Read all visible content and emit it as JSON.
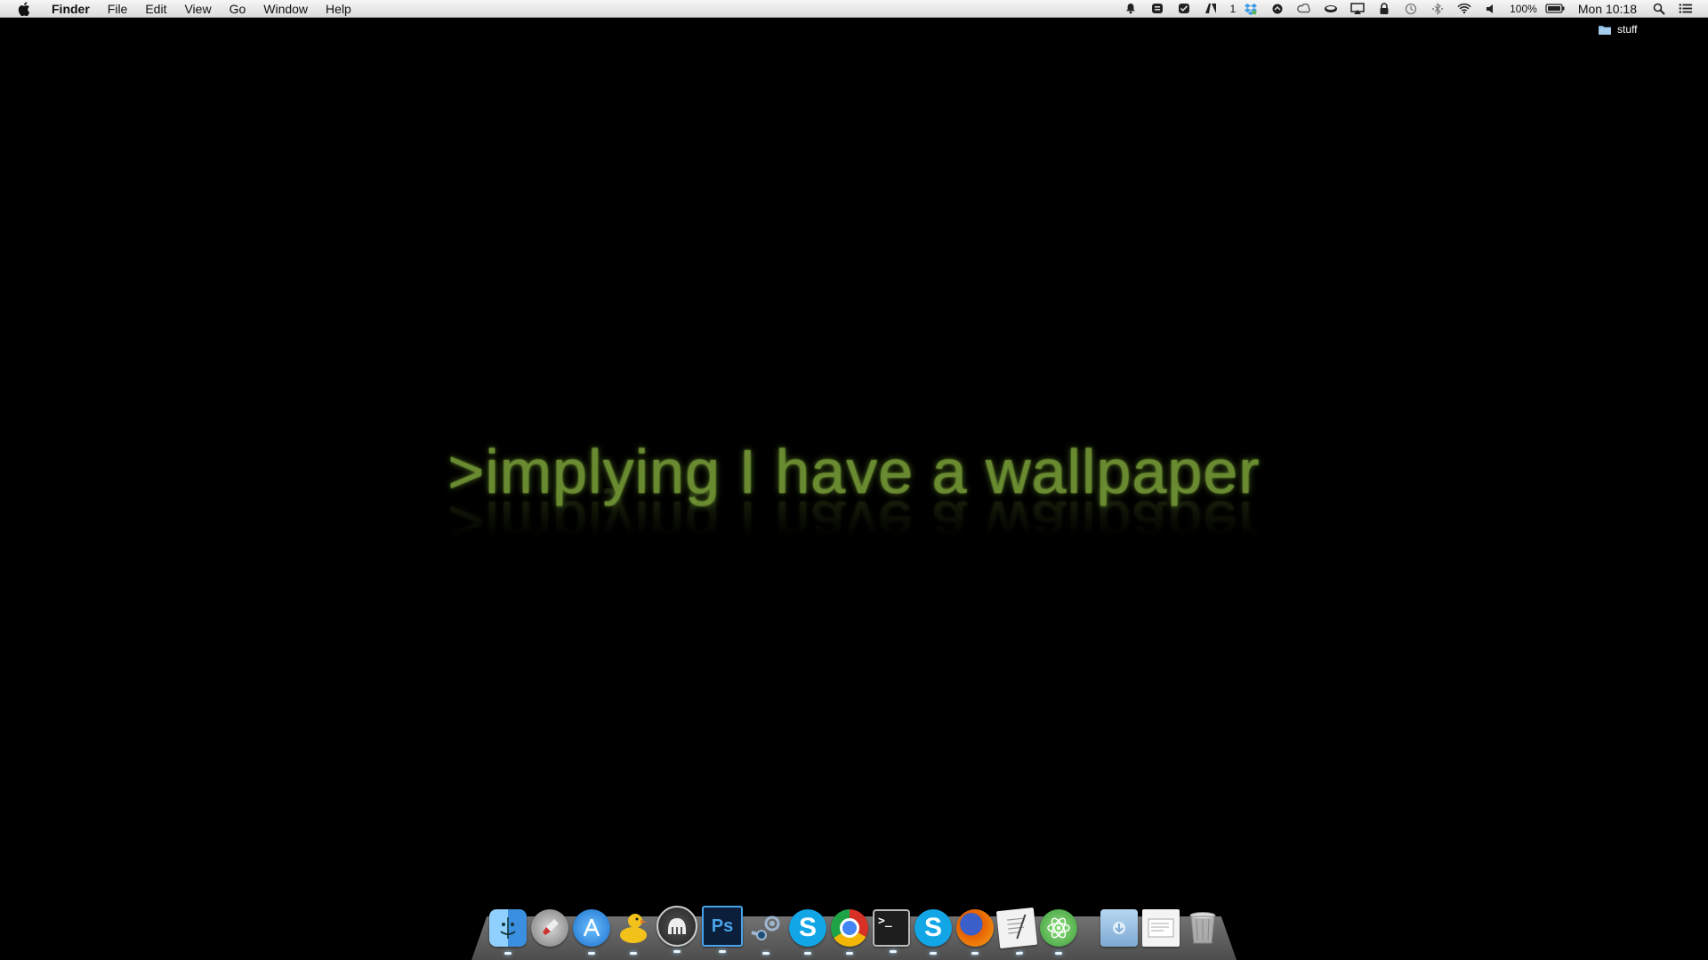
{
  "menubar": {
    "app_name": "Finder",
    "menus": [
      "File",
      "Edit",
      "View",
      "Go",
      "Window",
      "Help"
    ],
    "status": {
      "badge_count": "1",
      "battery": "100%",
      "clock": "Mon 10:18"
    }
  },
  "desktop": {
    "items": [
      {
        "label": "stuff",
        "icon": "folder-icon"
      }
    ],
    "wallpaper_text": ">implying I have a wallpaper"
  },
  "dock": {
    "apps": [
      {
        "name": "finder-icon",
        "color": "#5aa8e8"
      },
      {
        "name": "launchpad-icon",
        "color": "#9a9a9a"
      },
      {
        "name": "app-store-icon",
        "color": "#2f8ee0"
      },
      {
        "name": "cyberduck-icon",
        "color": "#f2c21a"
      },
      {
        "name": "mamp-icon",
        "color": "#e8e8e8"
      },
      {
        "name": "photoshop-icon",
        "label": "Ps",
        "color": "#0c1f3a"
      },
      {
        "name": "steam-icon",
        "color": "#1f4f78"
      },
      {
        "name": "skype-icon",
        "label": "S",
        "color": "#13a6e6"
      },
      {
        "name": "chrome-icon",
        "color": "#d93025"
      },
      {
        "name": "terminal-icon",
        "label": ">_",
        "color": "#222222"
      },
      {
        "name": "skype-icon-2",
        "label": "S",
        "color": "#13a6e6"
      },
      {
        "name": "firefox-icon",
        "color": "#e66000"
      },
      {
        "name": "textedit-icon",
        "color": "#eeeeee"
      },
      {
        "name": "atom-icon",
        "color": "#66c05b"
      }
    ],
    "stacks": [
      {
        "name": "downloads-stack-icon",
        "color": "#8cb8e0"
      },
      {
        "name": "documents-stack-icon",
        "color": "#f4f4f4"
      },
      {
        "name": "trash-icon",
        "color": "#c8c8c8"
      }
    ]
  }
}
